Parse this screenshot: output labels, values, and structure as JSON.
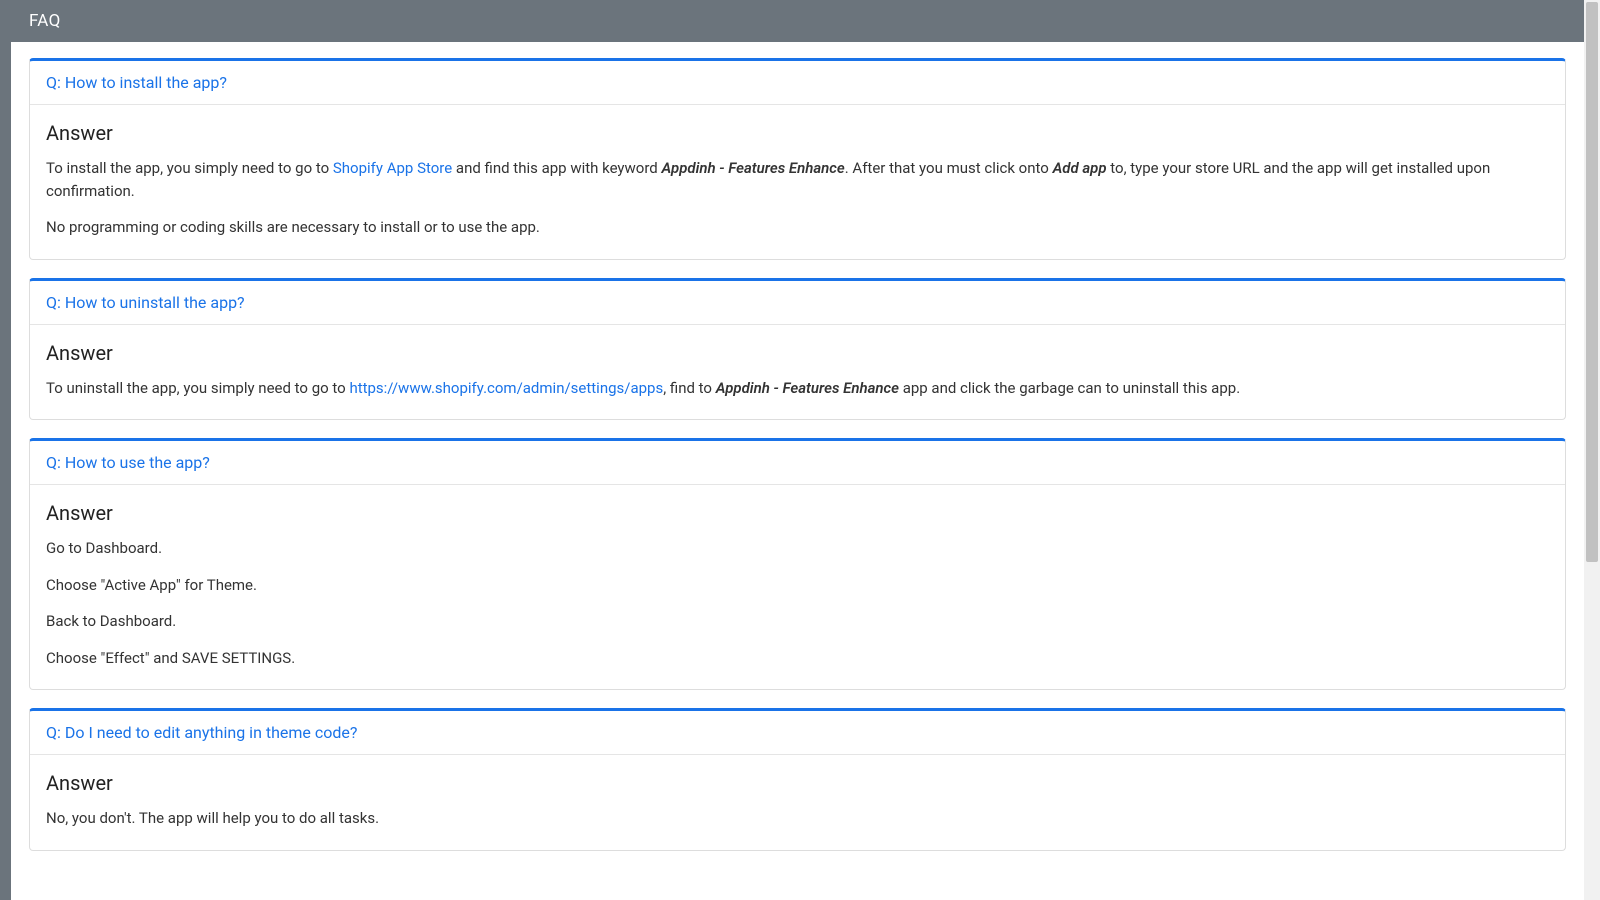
{
  "header": {
    "title": "FAQ"
  },
  "answer_label": "Answer",
  "faq": [
    {
      "q": "Q: How to install the app?",
      "body": {
        "p1a": "To install the app, you simply need to go to ",
        "link1": "Shopify App Store",
        "p1b": " and find this app with keyword ",
        "em1": "Appdinh - Features Enhance",
        "p1c": ". After that you must click onto ",
        "em2": "Add app",
        "p1d": " to, type your store URL and the app will get installed upon confirmation.",
        "p2": "No programming or coding skills are necessary to install or to use the app."
      }
    },
    {
      "q": "Q: How to uninstall the app?",
      "body": {
        "p1a": "To uninstall the app, you simply need to go to ",
        "link1": "https://www.shopify.com/admin/settings/apps",
        "p1b": ", find to ",
        "em1": "Appdinh - Features Enhance",
        "p1c": " app and click the garbage can to uninstall this app."
      }
    },
    {
      "q": "Q: How to use the app?",
      "body": {
        "p1": "Go to Dashboard.",
        "p2": "Choose \"Active App\" for Theme.",
        "p3": "Back to Dashboard.",
        "p4": "Choose \"Effect\" and SAVE SETTINGS."
      }
    },
    {
      "q": "Q: Do I need to edit anything in theme code?",
      "body": {
        "p1": "No, you don't. The app will help you to do all tasks."
      }
    }
  ],
  "colors": {
    "accent": "#1a73e8",
    "header_bg": "#6b747c"
  }
}
